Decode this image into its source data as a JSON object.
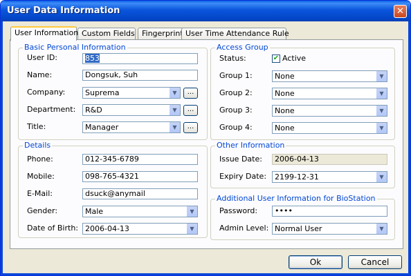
{
  "window": {
    "title": "User Data Information",
    "close_glyph": "✕"
  },
  "tabs": [
    {
      "label": "User Information",
      "active": true
    },
    {
      "label": "Custom Fields"
    },
    {
      "label": "Fingerprint"
    },
    {
      "label": "User Time Attendance Rule"
    }
  ],
  "basic": {
    "legend": "Basic Personal Information",
    "user_id_label": "User ID:",
    "user_id_value": "853",
    "name_label": "Name:",
    "name_value": "Dongsuk, Suh",
    "company_label": "Company:",
    "company_value": "Suprema",
    "department_label": "Department:",
    "department_value": "R&D",
    "title_label": "Title:",
    "title_value": "Manager",
    "ellipsis": "..."
  },
  "details": {
    "legend": "Details",
    "phone_label": "Phone:",
    "phone_value": "012-345-6789",
    "mobile_label": "Mobile:",
    "mobile_value": "098-765-4321",
    "email_label": "E-Mail:",
    "email_value": "dsuck@anymail",
    "gender_label": "Gender:",
    "gender_value": "Male",
    "dob_label": "Date of Birth:",
    "dob_value": "2006-04-13"
  },
  "access": {
    "legend": "Access Group",
    "status_label": "Status:",
    "status_value": "Active",
    "status_checked": true,
    "group1_label": "Group 1:",
    "group1_value": "None",
    "group2_label": "Group 2:",
    "group2_value": "None",
    "group3_label": "Group 3:",
    "group3_value": "None",
    "group4_label": "Group 4:",
    "group4_value": "None"
  },
  "other": {
    "legend": "Other Information",
    "issue_label": "Issue Date:",
    "issue_value": "2006-04-13",
    "expiry_label": "Expiry Date:",
    "expiry_value": "2199-12-31"
  },
  "biostation": {
    "legend": "Additional User Information for BioStation",
    "password_label": "Password:",
    "password_value": "••••",
    "admin_label": "Admin Level:",
    "admin_value": "Normal User"
  },
  "buttons": {
    "ok": "Ok",
    "cancel": "Cancel"
  },
  "icons": {
    "dropdown": "chevron-down-icon",
    "checkmark": "✔"
  },
  "colors": {
    "title_bar": "#0a55dc",
    "group_legend": "#0046d5",
    "active_tab_accent": "#ffc83c"
  }
}
